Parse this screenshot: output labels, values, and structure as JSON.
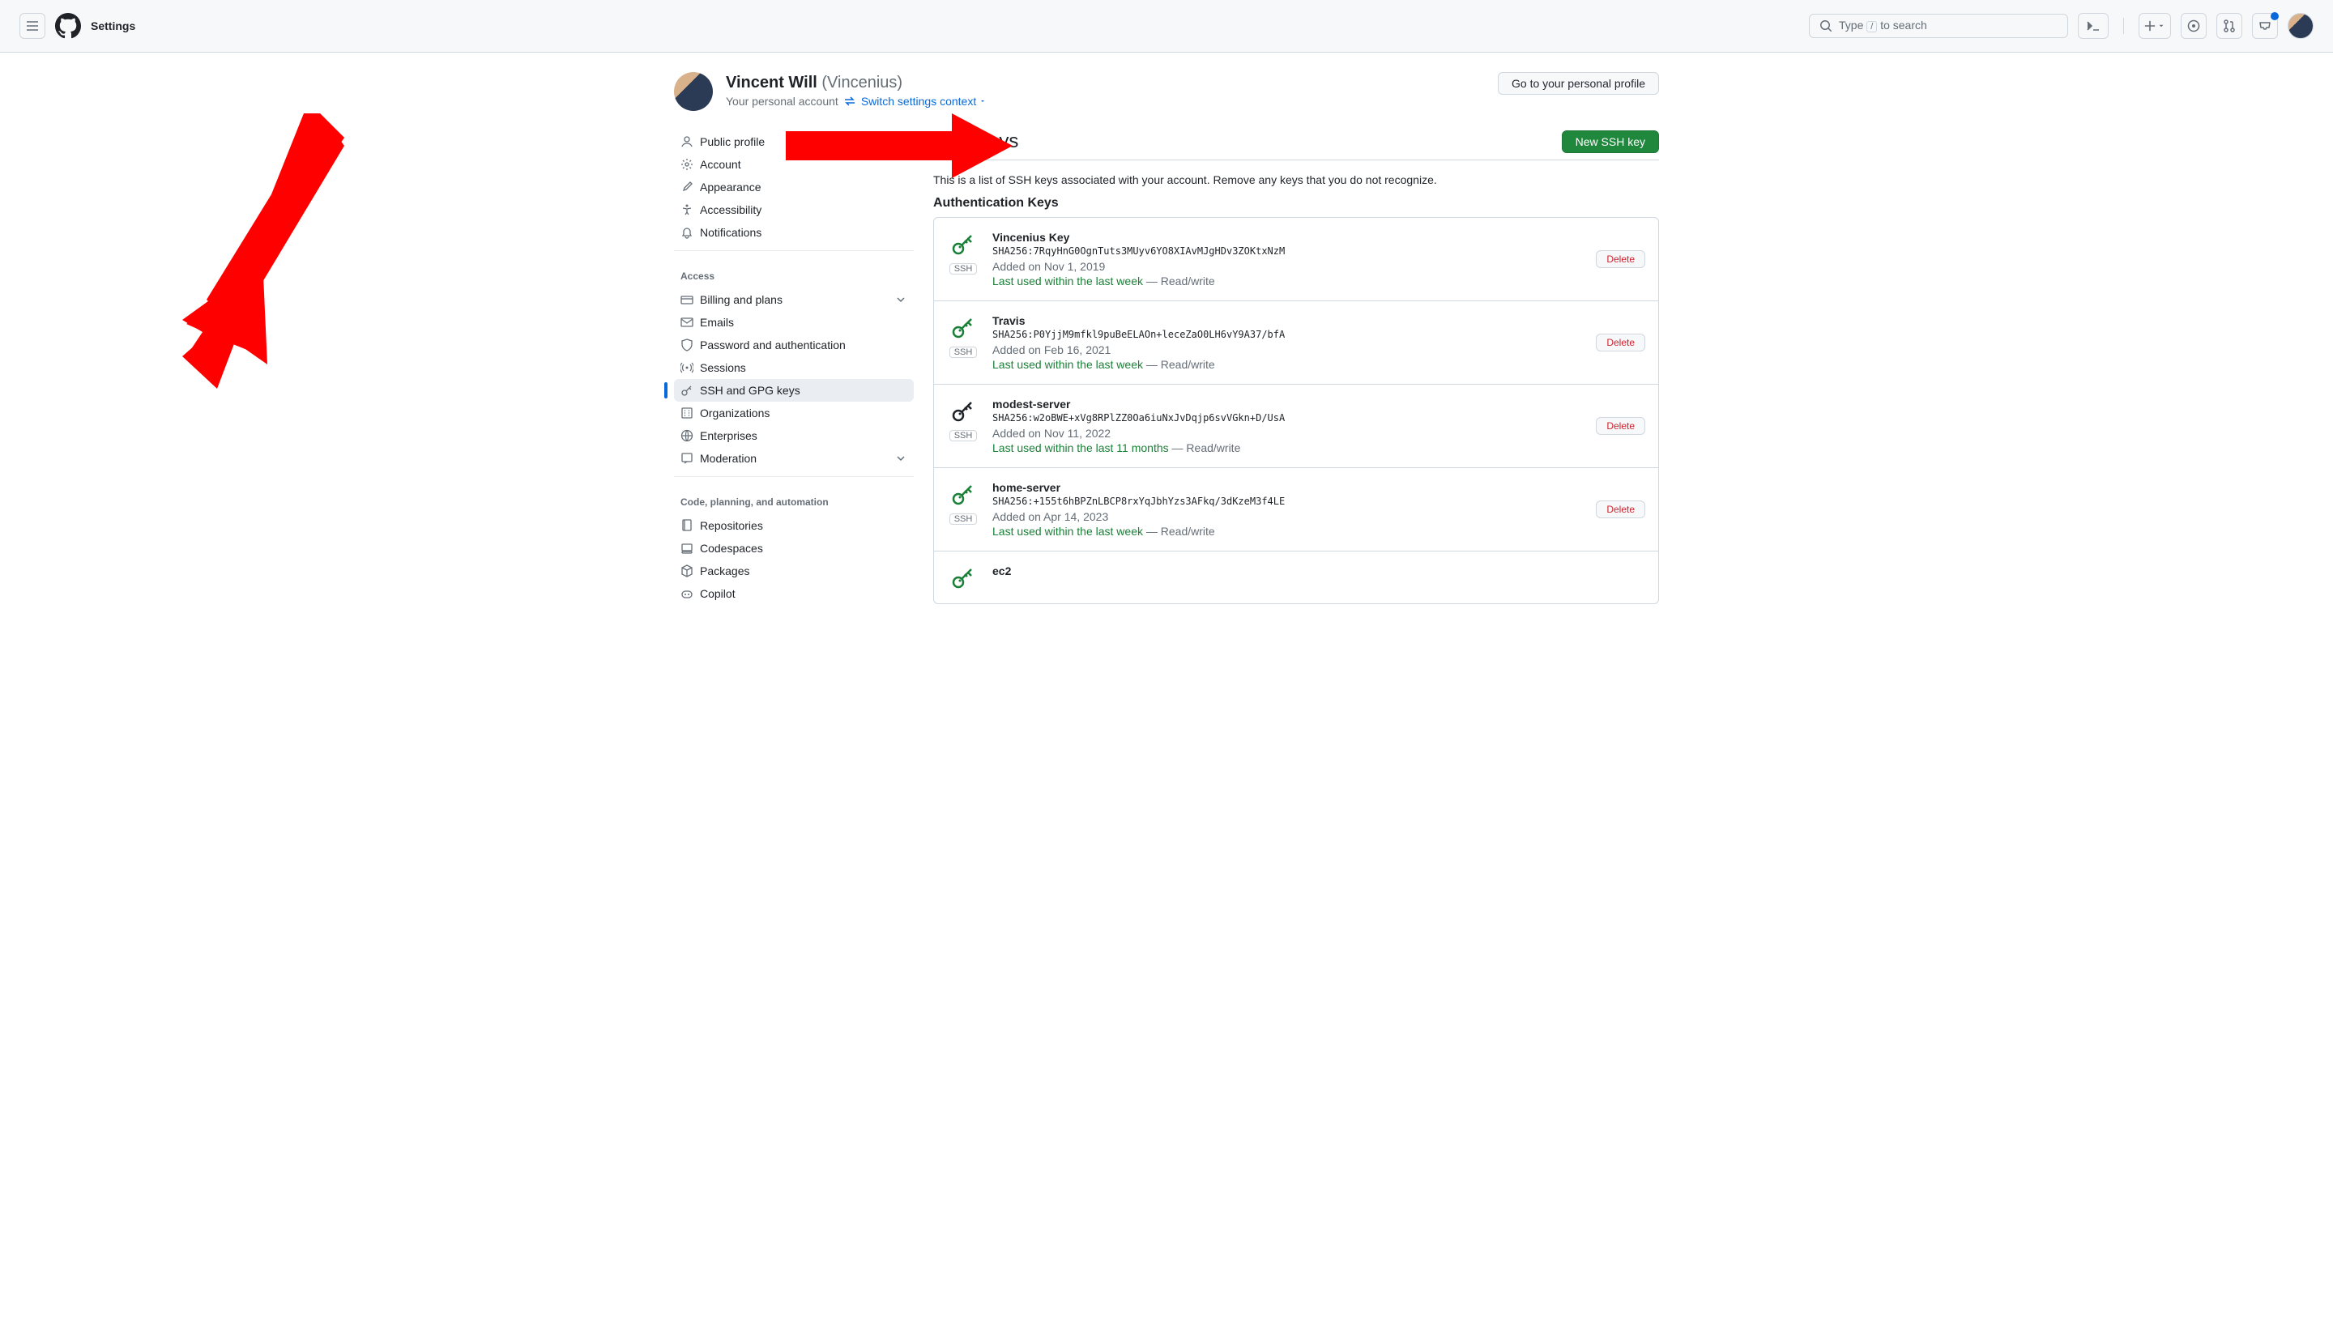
{
  "header": {
    "title": "Settings",
    "search_placeholder": "Type / to search",
    "search_key": "/"
  },
  "profile": {
    "name": "Vincent Will",
    "username": "(Vincenius)",
    "sub": "Your personal account",
    "switch_link": "Switch settings context",
    "goto_btn": "Go to your personal profile"
  },
  "sidebar": {
    "g0": [
      {
        "label": "Public profile",
        "icon": "person"
      },
      {
        "label": "Account",
        "icon": "gear"
      },
      {
        "label": "Appearance",
        "icon": "brush"
      },
      {
        "label": "Accessibility",
        "icon": "accessibility"
      },
      {
        "label": "Notifications",
        "icon": "bell"
      }
    ],
    "g1_title": "Access",
    "g1": [
      {
        "label": "Billing and plans",
        "icon": "card",
        "chev": true
      },
      {
        "label": "Emails",
        "icon": "mail"
      },
      {
        "label": "Password and authentication",
        "icon": "shield"
      },
      {
        "label": "Sessions",
        "icon": "broadcast"
      },
      {
        "label": "SSH and GPG keys",
        "icon": "key",
        "active": true
      },
      {
        "label": "Organizations",
        "icon": "org"
      },
      {
        "label": "Enterprises",
        "icon": "globe"
      },
      {
        "label": "Moderation",
        "icon": "report",
        "chev": true
      }
    ],
    "g2_title": "Code, planning, and automation",
    "g2": [
      {
        "label": "Repositories",
        "icon": "repo"
      },
      {
        "label": "Codespaces",
        "icon": "codespaces"
      },
      {
        "label": "Packages",
        "icon": "package"
      },
      {
        "label": "Copilot",
        "icon": "copilot"
      }
    ]
  },
  "main": {
    "heading": "SSH keys",
    "new_btn": "New SSH key",
    "desc": "This is a list of SSH keys associated with your account. Remove any keys that you do not recognize.",
    "auth_title": "Authentication Keys",
    "ssh_badge": "SSH",
    "delete_btn": "Delete",
    "dash": " — ",
    "keys": [
      {
        "name": "Vincenius Key",
        "fp": "SHA256:7RqyHnG0OgnTuts3MUyv6YO8XIAvMJgHDv3ZOKtxNzM",
        "added": "Added on Nov 1, 2019",
        "used": "Last used within the last week",
        "rw": "Read/write",
        "green": true
      },
      {
        "name": "Travis",
        "fp": "SHA256:P0YjjM9mfkl9puBeELAOn+leceZaO0LH6vY9A37/bfA",
        "added": "Added on Feb 16, 2021",
        "used": "Last used within the last week",
        "rw": "Read/write",
        "green": true
      },
      {
        "name": "modest-server",
        "fp": "SHA256:w2oBWE+xVg8RPlZZ0Oa6iuNxJvDqjp6svVGkn+D/UsA",
        "added": "Added on Nov 11, 2022",
        "used": "Last used within the last 11 months",
        "rw": "Read/write",
        "green": false
      },
      {
        "name": "home-server",
        "fp": "SHA256:+155t6hBPZnLBCP8rxYqJbhYzs3AFkq/3dKzeM3f4LE",
        "added": "Added on Apr 14, 2023",
        "used": "Last used within the last week",
        "rw": "Read/write",
        "green": true
      },
      {
        "name": "ec2",
        "fp": "",
        "added": "",
        "used": "",
        "rw": "",
        "green": true
      }
    ]
  }
}
